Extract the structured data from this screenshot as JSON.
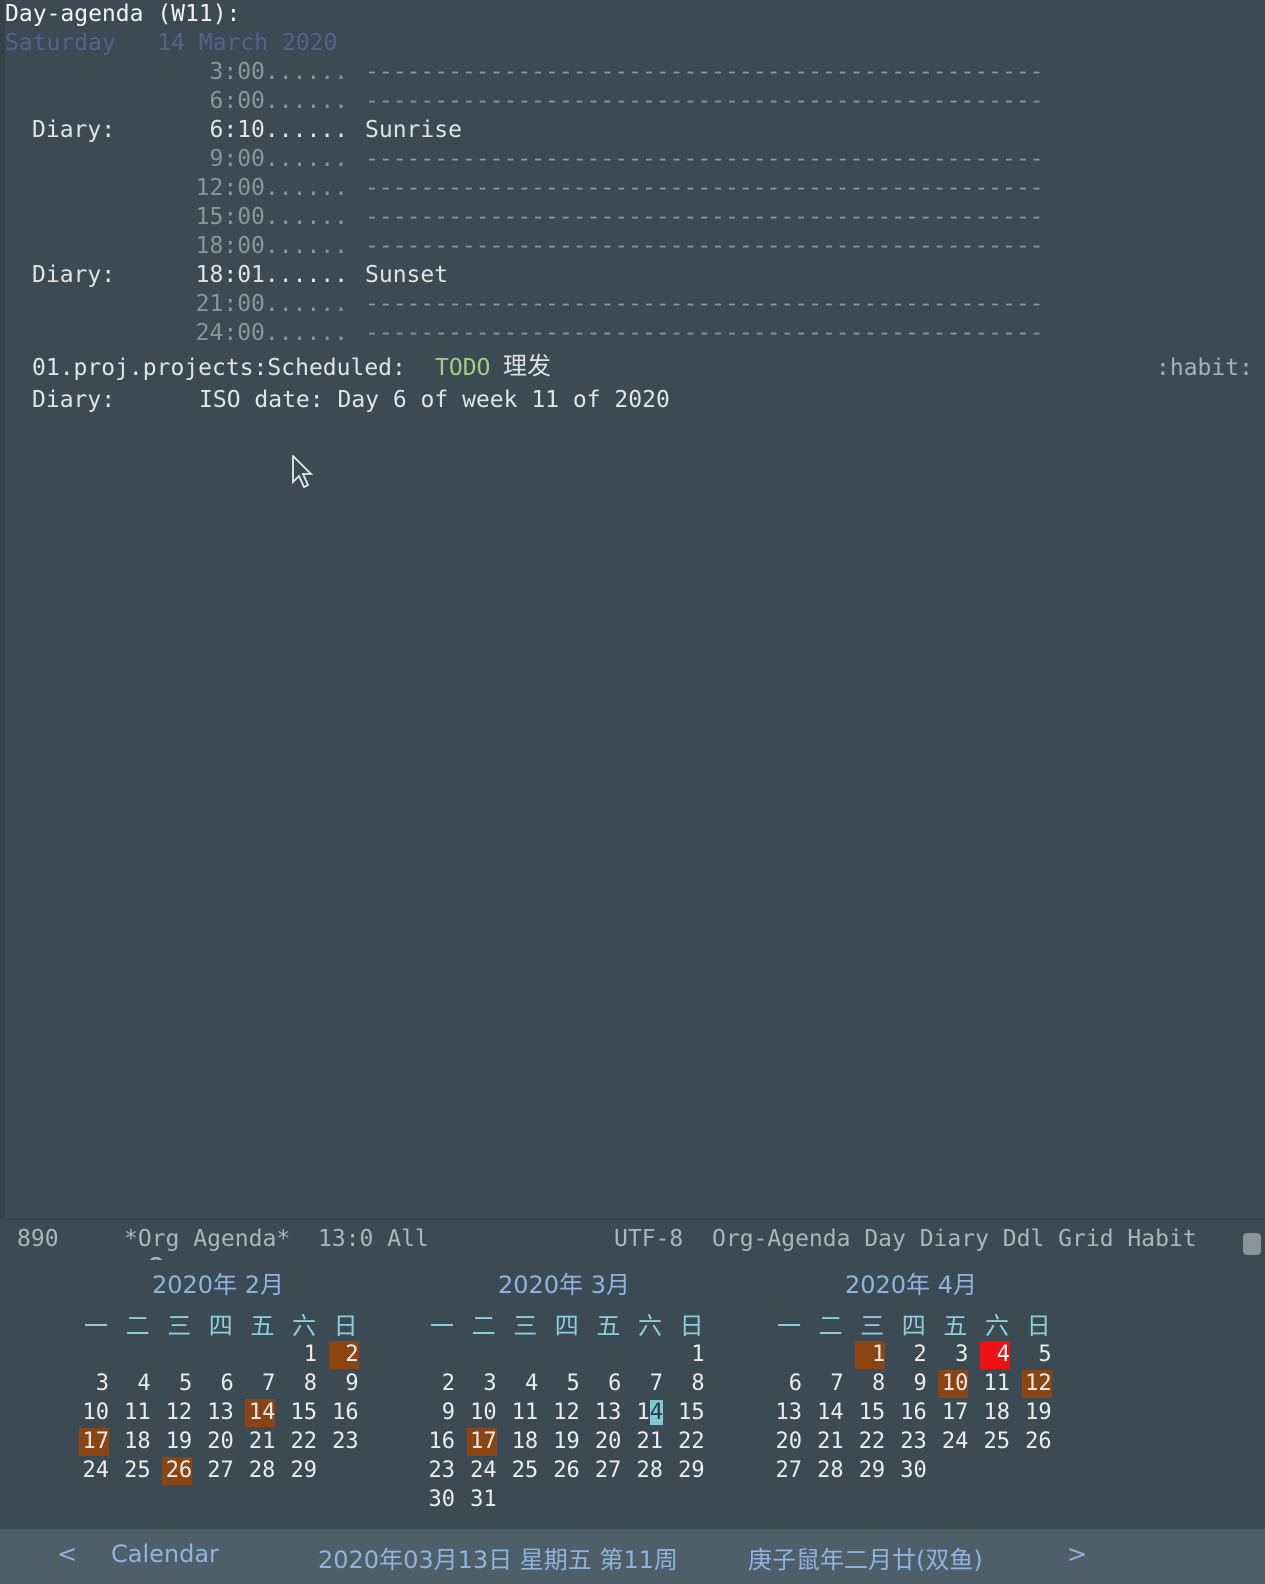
{
  "agenda": {
    "header": "Day-agenda (W11):",
    "date_line": "Saturday   14 March 2020",
    "lines": [
      {
        "label": "",
        "time": "3:00......",
        "text": "-------------------------------------------------",
        "kind": "grid"
      },
      {
        "label": "",
        "time": "6:00......",
        "text": "-------------------------------------------------",
        "kind": "grid"
      },
      {
        "label": "Diary:",
        "time": "6:10......",
        "text": "Sunrise",
        "kind": "entry"
      },
      {
        "label": "",
        "time": "9:00......",
        "text": "-------------------------------------------------",
        "kind": "grid"
      },
      {
        "label": "",
        "time": "12:00......",
        "text": "-------------------------------------------------",
        "kind": "grid"
      },
      {
        "label": "",
        "time": "15:00......",
        "text": "-------------------------------------------------",
        "kind": "grid"
      },
      {
        "label": "",
        "time": "18:00......",
        "text": "-------------------------------------------------",
        "kind": "grid"
      },
      {
        "label": "Diary:",
        "time": "18:01......",
        "text": "Sunset",
        "kind": "entry"
      },
      {
        "label": "",
        "time": "21:00......",
        "text": "-------------------------------------------------",
        "kind": "grid"
      },
      {
        "label": "",
        "time": "24:00......",
        "text": "-------------------------------------------------",
        "kind": "grid"
      }
    ],
    "scheduled": {
      "category": "01.proj.projects:Scheduled:",
      "keyword": "TODO",
      "title": "理发",
      "tag": ":habit:"
    },
    "iso_diary": {
      "label": "Diary:",
      "text": "ISO date: Day 6 of week 11 of 2020"
    }
  },
  "modeline": {
    "line_count": "890",
    "buffer_name": "*Org Agenda*",
    "position": "13:0 All",
    "encoding": "UTF-8",
    "modes": "Org-Agenda Day Diary Ddl Grid Habit",
    "lock_icon": "lock-icon"
  },
  "calendar": {
    "weekdays": [
      "一",
      "二",
      "三",
      "四",
      "五",
      "六",
      "日"
    ],
    "months": [
      {
        "title": "2020年 2月",
        "first_col": 5,
        "days": 29,
        "marked": [
          2,
          14,
          17,
          26
        ],
        "red": [],
        "cursor": null
      },
      {
        "title": "2020年 3月",
        "first_col": 6,
        "days": 31,
        "marked": [
          17
        ],
        "red": [],
        "cursor": 14
      },
      {
        "title": "2020年 4月",
        "first_col": 2,
        "days": 30,
        "marked": [
          1,
          10,
          12
        ],
        "red": [
          4
        ],
        "cursor": null
      }
    ],
    "bar": {
      "prev": "<",
      "label": "Calendar",
      "date_text": "2020年03月13日 星期五 第11周",
      "lunar_text": "庚子鼠年二月廿(双鱼)",
      "next": ">"
    }
  },
  "colors": {
    "background": "#3b4a53",
    "todo": "#a9c97d",
    "date_header": "#5b5f8e",
    "calendar_mark": "#8b4513",
    "calendar_red": "#ee1111"
  }
}
